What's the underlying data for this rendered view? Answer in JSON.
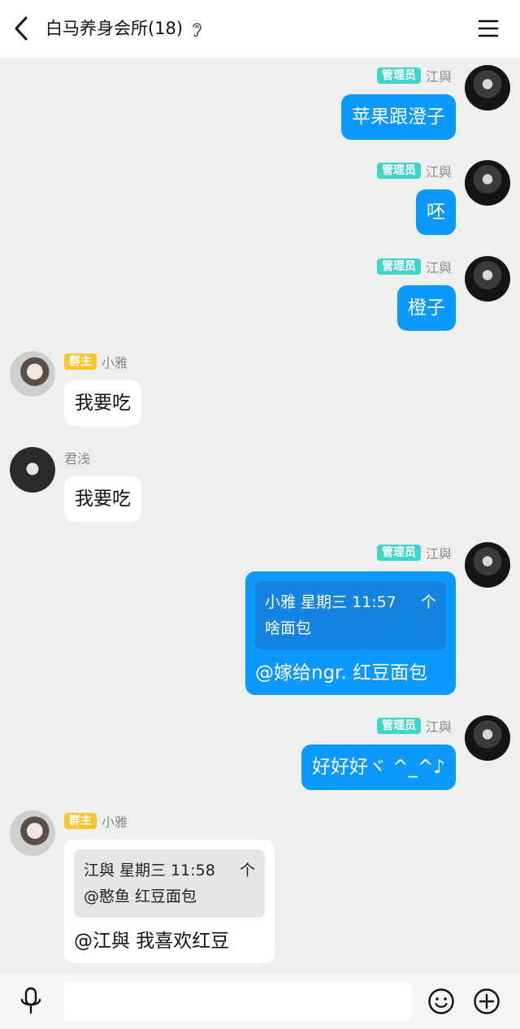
{
  "header": {
    "back_icon": "chevron-left-icon",
    "title": "白马养身会所(18)",
    "ear_icon": "ear-icon",
    "menu_icon": "hamburger-menu-icon"
  },
  "messages": [
    {
      "side": "right",
      "badge": "管理员",
      "name": "江與",
      "text": "苹果跟澄子"
    },
    {
      "side": "right",
      "badge": "管理员",
      "name": "江與",
      "text": "呸"
    },
    {
      "side": "right",
      "badge": "管理员",
      "name": "江與",
      "text": "橙子"
    },
    {
      "side": "left",
      "badge": "群主",
      "name": "小雅",
      "text": "我要吃"
    },
    {
      "side": "left",
      "badge": "",
      "name": "君浅",
      "text": "我要吃"
    },
    {
      "side": "right",
      "badge": "管理员",
      "name": "江與",
      "quote_head": "小雅 星期三 11:57",
      "quote_up": "个",
      "quote_text": "啥面包",
      "text": "@嫁给ngr. 红豆面包"
    },
    {
      "side": "right",
      "badge": "管理员",
      "name": "江與",
      "text": "好好好ヾ ^_^♪"
    },
    {
      "side": "left",
      "badge": "群主",
      "name": "小雅",
      "quote_head": "江與 星期三 11:58",
      "quote_up": "个",
      "quote_text": "@憨鱼 红豆面包",
      "text": "@江與 我喜欢红豆"
    }
  ],
  "footer": {
    "mic_icon": "microphone-icon",
    "input_value": "",
    "input_placeholder": "",
    "emoji_icon": "smiley-face-icon",
    "plus_icon": "plus-circle-icon"
  },
  "colors": {
    "background": "#eef0ef",
    "self_bubble": "#0b99ff",
    "admin_badge": "#3fd5c8",
    "owner_badge": "#fbc62c"
  }
}
